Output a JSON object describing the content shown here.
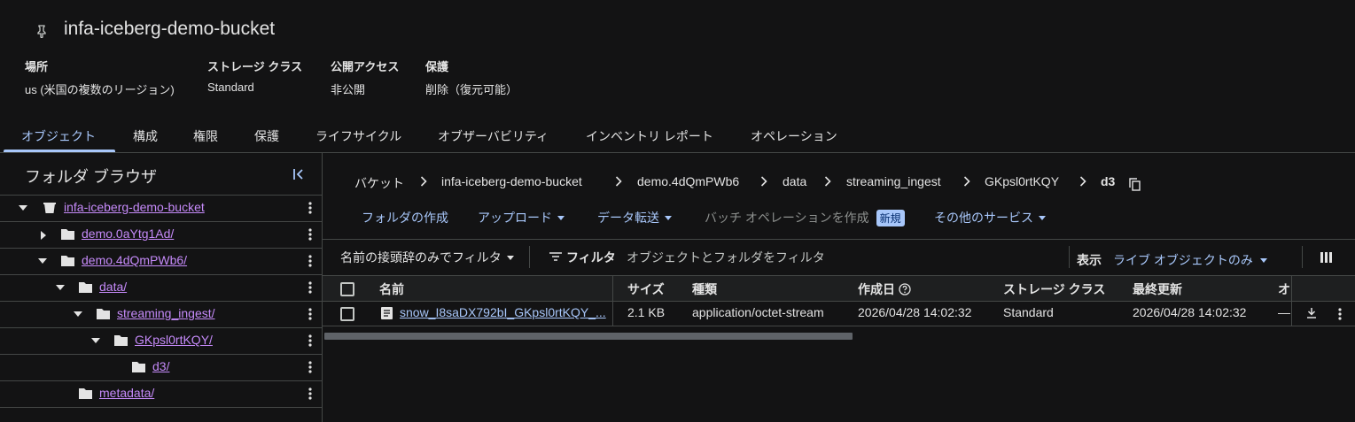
{
  "bucket": {
    "title": "infa-iceberg-demo-bucket",
    "meta": [
      {
        "label": "場所",
        "value": "us (米国の複数のリージョン)"
      },
      {
        "label": "ストレージ クラス",
        "value": "Standard"
      },
      {
        "label": "公開アクセス",
        "value": "非公開"
      },
      {
        "label": "保護",
        "value": "削除（復元可能）"
      }
    ]
  },
  "tabs": [
    "オブジェクト",
    "構成",
    "権限",
    "保護",
    "ライフサイクル",
    "オブザーバビリティ",
    "インベントリ レポート",
    "オペレーション"
  ],
  "folder_browser": {
    "title": "フォルダ ブラウザ",
    "items": [
      {
        "label": "infa-iceberg-demo-bucket"
      },
      {
        "label": "demo.0aYtg1Ad/"
      },
      {
        "label": "demo.4dQmPWb6/"
      },
      {
        "label": "data/"
      },
      {
        "label": "streaming_ingest/"
      },
      {
        "label": "GKpsl0rtKQY/"
      },
      {
        "label": "d3/"
      },
      {
        "label": "metadata/"
      }
    ]
  },
  "breadcrumb": [
    "バケット",
    "infa-iceberg-demo-bucket",
    "demo.4dQmPWb6",
    "data",
    "streaming_ingest",
    "GKpsl0rtKQY",
    "d3"
  ],
  "actions": {
    "create_folder": "フォルダの作成",
    "upload": "アップロード",
    "transfer": "データ転送",
    "batch_ops": "バッチ オペレーションを作成",
    "new_badge": "新規",
    "other_services": "その他のサービス"
  },
  "filter_bar": {
    "prefix_filter": "名前の接頭辞のみでフィルタ",
    "filter_label": "フィルタ",
    "filter_placeholder": "オブジェクトとフォルダをフィルタ",
    "view_label": "表示",
    "view_value": "ライブ オブジェクトのみ"
  },
  "table": {
    "headers": {
      "name": "名前",
      "size": "サイズ",
      "type": "種類",
      "created": "作成日",
      "storage_class": "ストレージ クラス",
      "updated": "最終更新",
      "extra": "オ"
    },
    "rows": [
      {
        "name": "snow_I8saDX792bI_GKpsl0rtKQY_...",
        "size": "2.1 KB",
        "type": "application/octet-stream",
        "created": "2026/04/28 14:02:32",
        "storage_class": "Standard",
        "updated": "2026/04/28 14:02:32",
        "extra": "—"
      }
    ]
  },
  "colors": {
    "background": "#131314",
    "accent": "#a8c7fa",
    "link_visited": "#c58af9"
  }
}
